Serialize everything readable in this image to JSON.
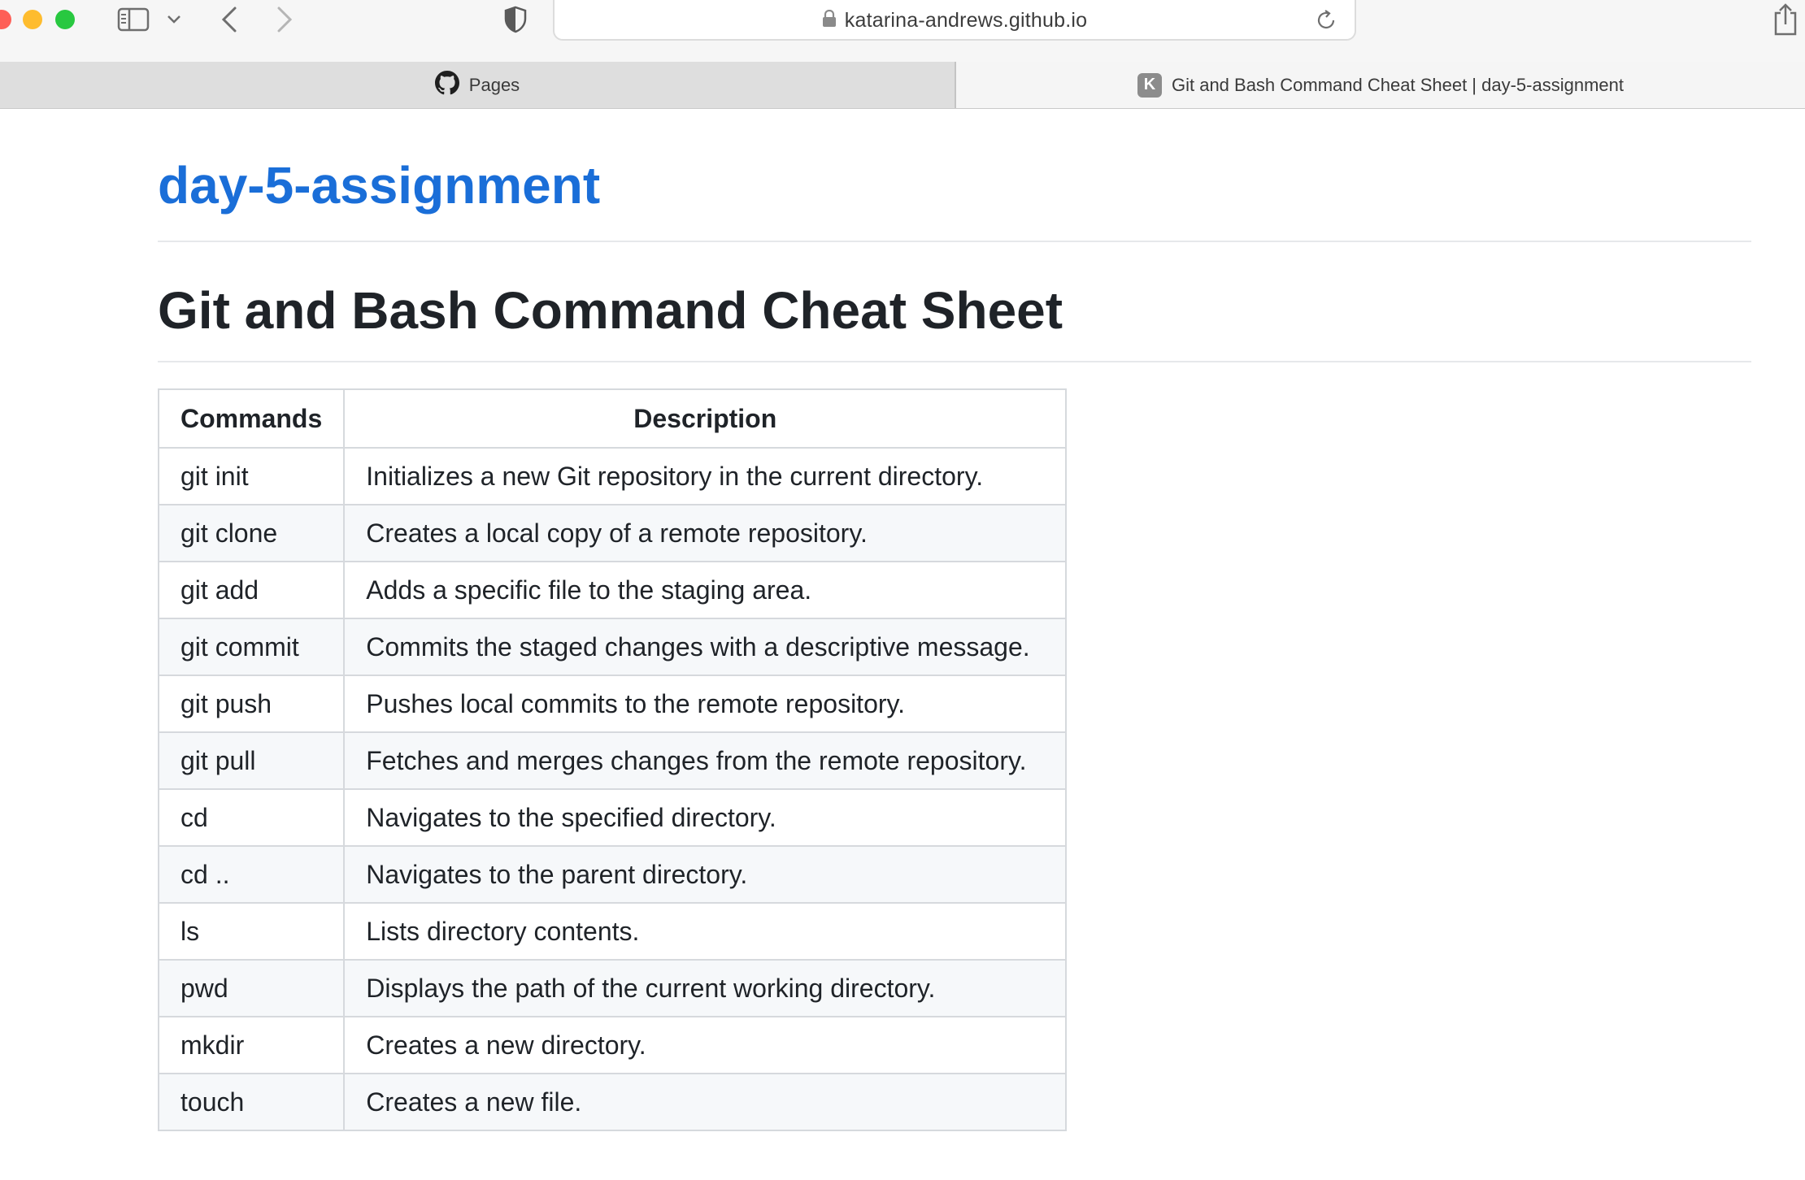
{
  "browser": {
    "url": "katarina-andrews.github.io",
    "tabs": [
      {
        "label": "Pages",
        "icon": "github-icon",
        "active": false
      },
      {
        "label": "Git and Bash Command Cheat Sheet | day-5-assignment",
        "favicon_letter": "K",
        "active": true
      }
    ]
  },
  "page": {
    "site_title": "day-5-assignment",
    "heading": "Git and Bash Command Cheat Sheet",
    "table": {
      "headers": [
        "Commands",
        "Description"
      ],
      "rows": [
        [
          "git init",
          "Initializes a new Git repository in the current directory."
        ],
        [
          "git clone",
          "Creates a local copy of a remote repository."
        ],
        [
          "git add",
          "Adds a specific file to the staging area."
        ],
        [
          "git commit",
          "Commits the staged changes with a descriptive message."
        ],
        [
          "git push",
          "Pushes local commits to the remote repository."
        ],
        [
          "git pull",
          "Fetches and merges changes from the remote repository."
        ],
        [
          "cd",
          "Navigates to the specified directory."
        ],
        [
          "cd ..",
          "Navigates to the parent directory."
        ],
        [
          "ls",
          "Lists directory contents."
        ],
        [
          "pwd",
          "Displays the path of the current working directory."
        ],
        [
          "mkdir",
          "Creates a new directory."
        ],
        [
          "touch",
          "Creates a new file."
        ]
      ]
    }
  },
  "colors": {
    "link": "#1a6ed8",
    "text": "#1f2328",
    "table_border": "#d6d9dd",
    "row_stripe": "#f6f8fa"
  }
}
